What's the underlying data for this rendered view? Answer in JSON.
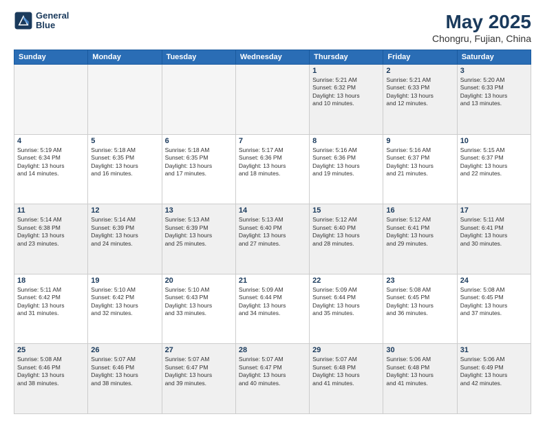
{
  "header": {
    "logo_line1": "General",
    "logo_line2": "Blue",
    "title": "May 2025",
    "subtitle": "Chongru, Fujian, China"
  },
  "weekdays": [
    "Sunday",
    "Monday",
    "Tuesday",
    "Wednesday",
    "Thursday",
    "Friday",
    "Saturday"
  ],
  "weeks": [
    [
      {
        "day": "",
        "info": "",
        "empty": true
      },
      {
        "day": "",
        "info": "",
        "empty": true
      },
      {
        "day": "",
        "info": "",
        "empty": true
      },
      {
        "day": "",
        "info": "",
        "empty": true
      },
      {
        "day": "1",
        "info": "Sunrise: 5:21 AM\nSunset: 6:32 PM\nDaylight: 13 hours\nand 10 minutes."
      },
      {
        "day": "2",
        "info": "Sunrise: 5:21 AM\nSunset: 6:33 PM\nDaylight: 13 hours\nand 12 minutes."
      },
      {
        "day": "3",
        "info": "Sunrise: 5:20 AM\nSunset: 6:33 PM\nDaylight: 13 hours\nand 13 minutes."
      }
    ],
    [
      {
        "day": "4",
        "info": "Sunrise: 5:19 AM\nSunset: 6:34 PM\nDaylight: 13 hours\nand 14 minutes."
      },
      {
        "day": "5",
        "info": "Sunrise: 5:18 AM\nSunset: 6:35 PM\nDaylight: 13 hours\nand 16 minutes."
      },
      {
        "day": "6",
        "info": "Sunrise: 5:18 AM\nSunset: 6:35 PM\nDaylight: 13 hours\nand 17 minutes."
      },
      {
        "day": "7",
        "info": "Sunrise: 5:17 AM\nSunset: 6:36 PM\nDaylight: 13 hours\nand 18 minutes."
      },
      {
        "day": "8",
        "info": "Sunrise: 5:16 AM\nSunset: 6:36 PM\nDaylight: 13 hours\nand 19 minutes."
      },
      {
        "day": "9",
        "info": "Sunrise: 5:16 AM\nSunset: 6:37 PM\nDaylight: 13 hours\nand 21 minutes."
      },
      {
        "day": "10",
        "info": "Sunrise: 5:15 AM\nSunset: 6:37 PM\nDaylight: 13 hours\nand 22 minutes."
      }
    ],
    [
      {
        "day": "11",
        "info": "Sunrise: 5:14 AM\nSunset: 6:38 PM\nDaylight: 13 hours\nand 23 minutes."
      },
      {
        "day": "12",
        "info": "Sunrise: 5:14 AM\nSunset: 6:39 PM\nDaylight: 13 hours\nand 24 minutes."
      },
      {
        "day": "13",
        "info": "Sunrise: 5:13 AM\nSunset: 6:39 PM\nDaylight: 13 hours\nand 25 minutes."
      },
      {
        "day": "14",
        "info": "Sunrise: 5:13 AM\nSunset: 6:40 PM\nDaylight: 13 hours\nand 27 minutes."
      },
      {
        "day": "15",
        "info": "Sunrise: 5:12 AM\nSunset: 6:40 PM\nDaylight: 13 hours\nand 28 minutes."
      },
      {
        "day": "16",
        "info": "Sunrise: 5:12 AM\nSunset: 6:41 PM\nDaylight: 13 hours\nand 29 minutes."
      },
      {
        "day": "17",
        "info": "Sunrise: 5:11 AM\nSunset: 6:41 PM\nDaylight: 13 hours\nand 30 minutes."
      }
    ],
    [
      {
        "day": "18",
        "info": "Sunrise: 5:11 AM\nSunset: 6:42 PM\nDaylight: 13 hours\nand 31 minutes."
      },
      {
        "day": "19",
        "info": "Sunrise: 5:10 AM\nSunset: 6:42 PM\nDaylight: 13 hours\nand 32 minutes."
      },
      {
        "day": "20",
        "info": "Sunrise: 5:10 AM\nSunset: 6:43 PM\nDaylight: 13 hours\nand 33 minutes."
      },
      {
        "day": "21",
        "info": "Sunrise: 5:09 AM\nSunset: 6:44 PM\nDaylight: 13 hours\nand 34 minutes."
      },
      {
        "day": "22",
        "info": "Sunrise: 5:09 AM\nSunset: 6:44 PM\nDaylight: 13 hours\nand 35 minutes."
      },
      {
        "day": "23",
        "info": "Sunrise: 5:08 AM\nSunset: 6:45 PM\nDaylight: 13 hours\nand 36 minutes."
      },
      {
        "day": "24",
        "info": "Sunrise: 5:08 AM\nSunset: 6:45 PM\nDaylight: 13 hours\nand 37 minutes."
      }
    ],
    [
      {
        "day": "25",
        "info": "Sunrise: 5:08 AM\nSunset: 6:46 PM\nDaylight: 13 hours\nand 38 minutes."
      },
      {
        "day": "26",
        "info": "Sunrise: 5:07 AM\nSunset: 6:46 PM\nDaylight: 13 hours\nand 38 minutes."
      },
      {
        "day": "27",
        "info": "Sunrise: 5:07 AM\nSunset: 6:47 PM\nDaylight: 13 hours\nand 39 minutes."
      },
      {
        "day": "28",
        "info": "Sunrise: 5:07 AM\nSunset: 6:47 PM\nDaylight: 13 hours\nand 40 minutes."
      },
      {
        "day": "29",
        "info": "Sunrise: 5:07 AM\nSunset: 6:48 PM\nDaylight: 13 hours\nand 41 minutes."
      },
      {
        "day": "30",
        "info": "Sunrise: 5:06 AM\nSunset: 6:48 PM\nDaylight: 13 hours\nand 41 minutes."
      },
      {
        "day": "31",
        "info": "Sunrise: 5:06 AM\nSunset: 6:49 PM\nDaylight: 13 hours\nand 42 minutes."
      }
    ]
  ]
}
